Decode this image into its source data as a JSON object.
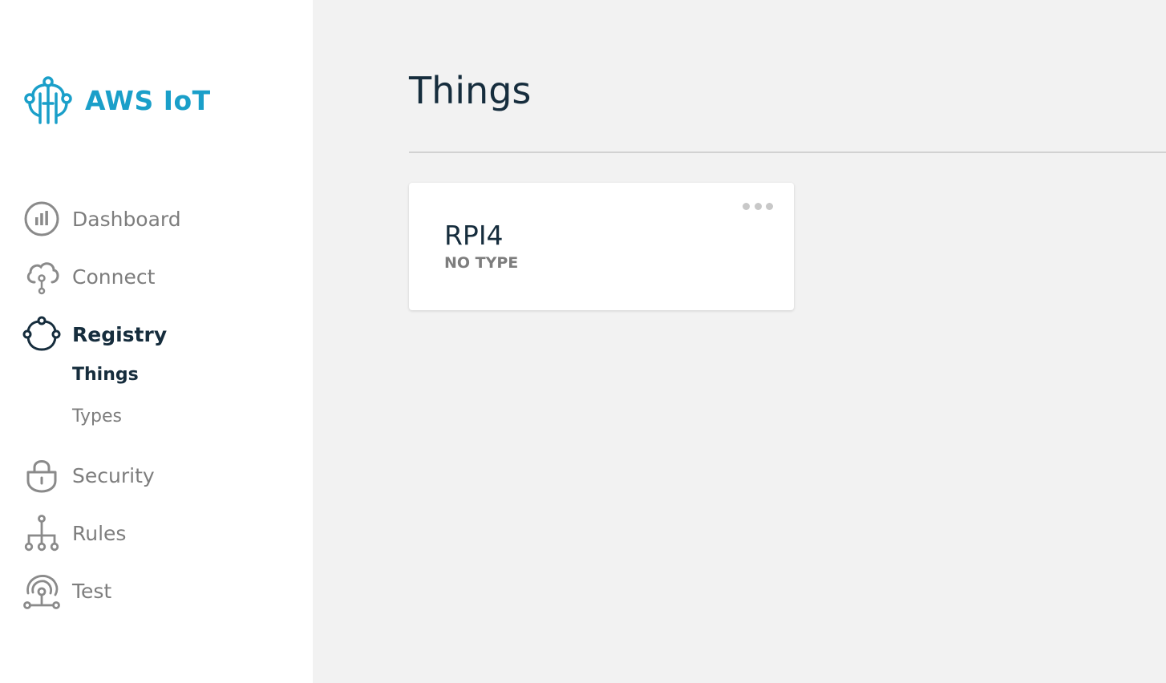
{
  "app": {
    "brand_name": "AWS IoT",
    "brand_color": "#1a9fc9"
  },
  "sidebar": {
    "items": [
      {
        "label": "Dashboard",
        "icon": "dashboard-icon"
      },
      {
        "label": "Connect",
        "icon": "cloud-connect-icon"
      },
      {
        "label": "Registry",
        "icon": "registry-icon",
        "active": true,
        "children": [
          {
            "label": "Things",
            "active": true
          },
          {
            "label": "Types"
          }
        ]
      },
      {
        "label": "Security",
        "icon": "lock-icon"
      },
      {
        "label": "Rules",
        "icon": "rules-tree-icon"
      },
      {
        "label": "Test",
        "icon": "broadcast-test-icon"
      }
    ]
  },
  "main": {
    "title": "Things",
    "things": [
      {
        "name": "RPI4",
        "type": "NO TYPE",
        "menu_icon": "more-horizontal-icon"
      }
    ]
  },
  "colors": {
    "text_dark": "#162d3d",
    "text_muted": "#7d7d7d",
    "background": "#f2f2f2"
  }
}
